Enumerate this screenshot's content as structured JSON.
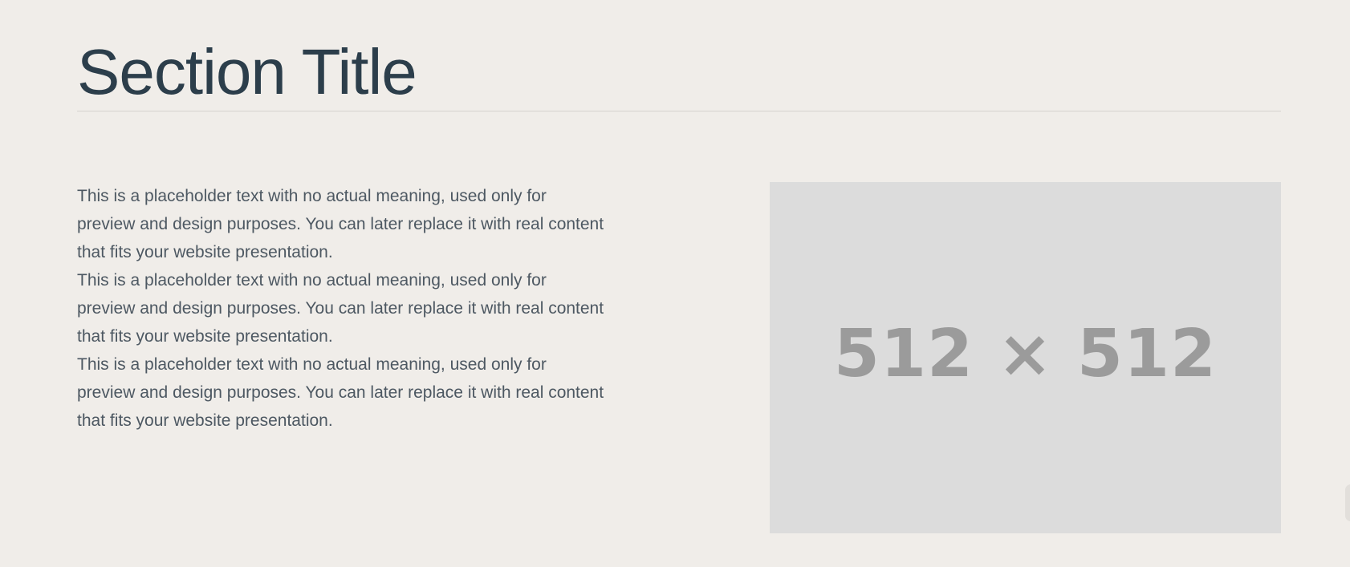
{
  "section": {
    "title": "Section Title",
    "paragraphs": [
      "This is a placeholder text with no actual meaning, used only for preview and design purposes. You can later replace it with real content that fits your website presentation.",
      "This is a placeholder text with no actual meaning, used only for preview and design purposes. You can later replace it with real content that fits your website presentation.",
      "This is a placeholder text with no actual meaning, used only for preview and design purposes. You can later replace it with real content that fits your website presentation."
    ],
    "image_placeholder": {
      "label": "512 × 512"
    }
  },
  "colors": {
    "background": "#f0ede9",
    "title": "#2c3e4b",
    "body_text": "#4d5862",
    "divider": "#d6d3cf",
    "placeholder_bg": "#dcdcdc",
    "placeholder_text": "#9b9b9b"
  }
}
